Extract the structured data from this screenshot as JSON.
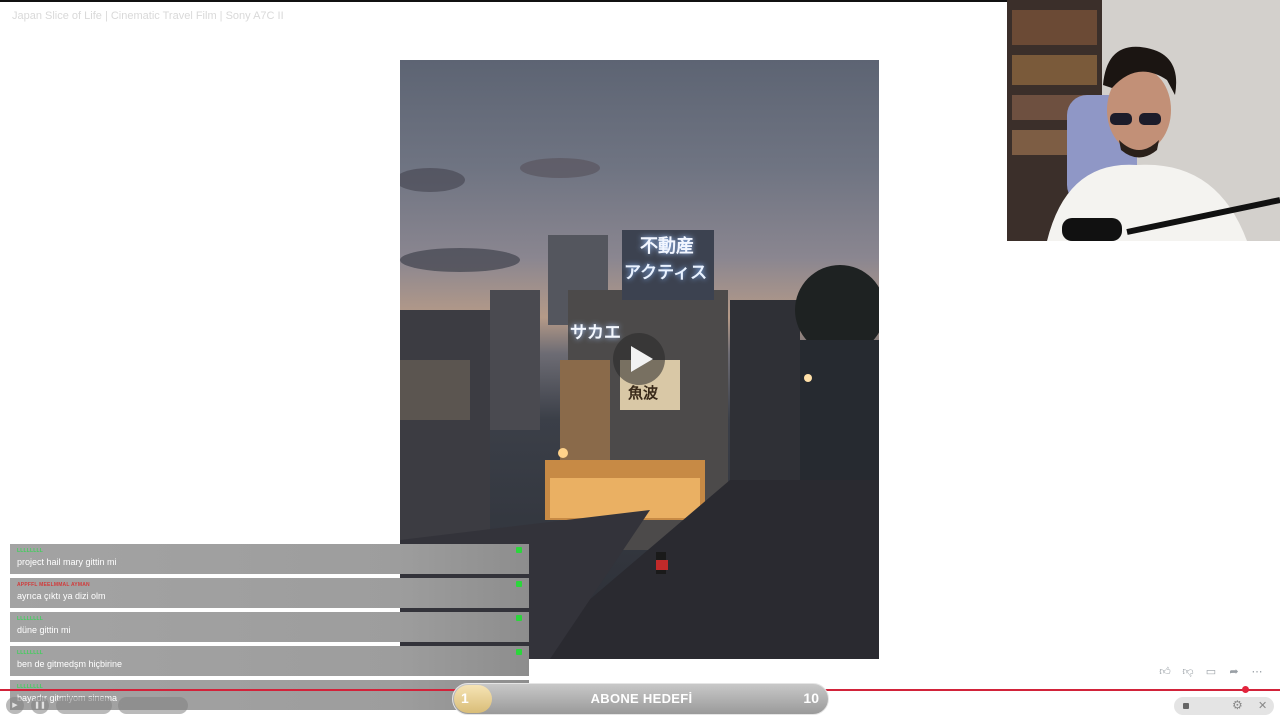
{
  "video": {
    "title": "Japan Slice of Life | Cinematic Travel Film | Sony A7C II",
    "play_icon": "play-icon",
    "signs": [
      "不動産",
      "アクティス",
      "サカエ",
      "魚波"
    ]
  },
  "chat": {
    "messages": [
      {
        "user": "LLLLLLLL",
        "user_color": "#3ecf5a",
        "text": "project hail mary gittin mi"
      },
      {
        "user": "APPFFL MEELMMAL AYMAN",
        "user_color": "#d23a3a",
        "text": "ayrıca çıktı ya dizi olm"
      },
      {
        "user": "LLLLLLLL",
        "user_color": "#3ecf5a",
        "text": "düne gittin mi"
      },
      {
        "user": "LLLLLLLL",
        "user_color": "#3ecf5a",
        "text": "ben de gitmedşm hiçbirine"
      },
      {
        "user": "LLLLLLLL",
        "user_color": "#3ecf5a",
        "text": "bayadır gitmiyom sinema"
      }
    ]
  },
  "goal": {
    "label": "ABONE HEDEFİ",
    "current": "1",
    "max": "10",
    "progress": 0.1
  },
  "player": {
    "progress_color": "#d2233a",
    "progress": 0.97,
    "controls": [
      "play-icon",
      "pause-icon"
    ]
  },
  "reactions": [
    "thumbs-up-icon",
    "thumbs-down-icon",
    "comment-icon",
    "share-icon",
    "more-icon"
  ]
}
